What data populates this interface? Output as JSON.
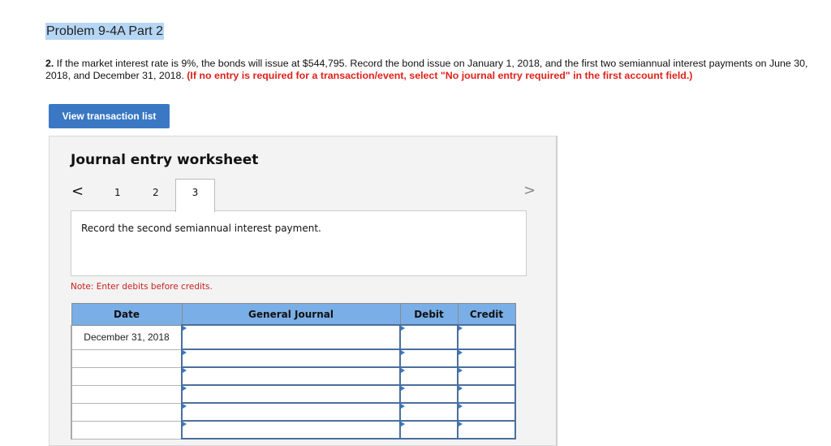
{
  "page": {
    "title": "Problem 9-4A Part 2",
    "question": {
      "number": "2.",
      "text": " If the market interest rate is 9%, the bonds will issue at $544,795. Record the bond issue on January 1, 2018, and the first two semiannual interest payments on June 30, 2018, and December 31, 2018. ",
      "instruction": "(If no entry is required for a transaction/event, select \"No journal entry required\" in the first account field.)"
    },
    "view_transaction_button": "View transaction list"
  },
  "worksheet": {
    "title": "Journal entry worksheet",
    "prev_icon": "<",
    "next_icon": ">",
    "tabs": [
      {
        "label": "1",
        "active": false
      },
      {
        "label": "2",
        "active": false
      },
      {
        "label": "3",
        "active": true
      }
    ],
    "description": "Record the second semiannual interest payment.",
    "note": "Note: Enter debits before credits.",
    "table": {
      "headers": {
        "date": "Date",
        "general_journal": "General Journal",
        "debit": "Debit",
        "credit": "Credit"
      },
      "rows": [
        {
          "date": "December 31, 2018",
          "account": "",
          "debit": "",
          "credit": ""
        },
        {
          "date": "",
          "account": "",
          "debit": "",
          "credit": ""
        },
        {
          "date": "",
          "account": "",
          "debit": "",
          "credit": ""
        },
        {
          "date": "",
          "account": "",
          "debit": "",
          "credit": ""
        },
        {
          "date": "",
          "account": "",
          "debit": "",
          "credit": ""
        },
        {
          "date": "",
          "account": "",
          "debit": "",
          "credit": ""
        }
      ]
    }
  },
  "colors": {
    "button_blue": "#3a78c3",
    "header_blue": "#7aaee6",
    "instruction_red": "#e0211b",
    "note_red": "#c8201d"
  }
}
